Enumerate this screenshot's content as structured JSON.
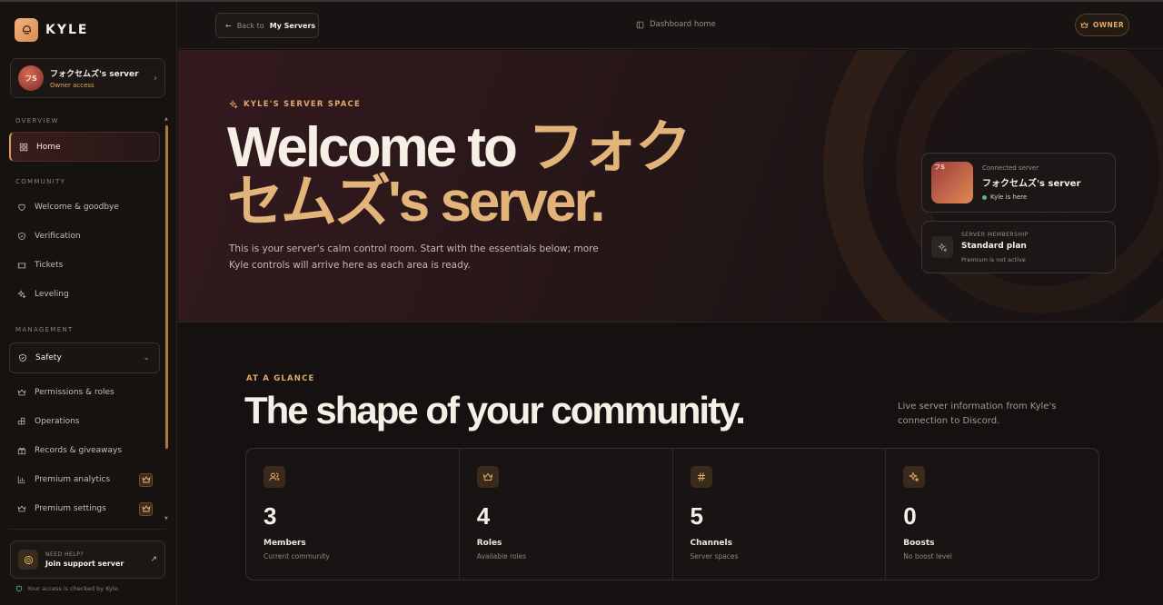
{
  "brand": {
    "name": "KYLE"
  },
  "server": {
    "initials": "フS",
    "name": "フォクセムズ's server",
    "access": "Owner access"
  },
  "sidebar": {
    "sections": {
      "overview": "OVERVIEW",
      "community": "COMMUNITY",
      "management": "MANAGEMENT"
    },
    "items": [
      {
        "label": "Home",
        "icon": "grid-icon"
      },
      {
        "label": "Welcome & goodbye",
        "icon": "heart-icon"
      },
      {
        "label": "Verification",
        "icon": "shield-check-icon"
      },
      {
        "label": "Tickets",
        "icon": "ticket-icon"
      },
      {
        "label": "Leveling",
        "icon": "sparkles-icon"
      },
      {
        "label": "Safety",
        "icon": "shield-icon"
      },
      {
        "label": "Permissions & roles",
        "icon": "crown-icon"
      },
      {
        "label": "Operations",
        "icon": "blocks-icon"
      },
      {
        "label": "Records & giveaways",
        "icon": "gift-icon"
      },
      {
        "label": "Premium analytics",
        "icon": "chart-icon"
      },
      {
        "label": "Premium settings",
        "icon": "crown-icon"
      }
    ],
    "help": {
      "kicker": "NEED HELP?",
      "title": "Join support server"
    },
    "access_note": "Your access is checked by Kyle."
  },
  "topbar": {
    "back_prefix": "Back to",
    "back_target": "My Servers",
    "dashboard": "Dashboard home",
    "role": "OWNER"
  },
  "hero": {
    "kicker": "KYLE'S SERVER SPACE",
    "title_lead": "Welcome to ",
    "title_accent": "フォクセムズ's server.",
    "description": "This is your server's calm control room. Start with the essentials below; more Kyle controls will arrive here as each area is ready.",
    "connected": {
      "kicker": "Connected server",
      "initials": "フS",
      "name": "フォクセムズ's server",
      "status": "Kyle is here"
    },
    "membership": {
      "kicker": "SERVER MEMBERSHIP",
      "plan": "Standard plan",
      "note": "Premium is not active"
    }
  },
  "glance": {
    "kicker": "AT A GLANCE",
    "title": "The shape of your community.",
    "note": "Live server information from Kyle's connection to Discord.",
    "stats": [
      {
        "value": "3",
        "label": "Members",
        "sub": "Current community",
        "icon": "users-icon"
      },
      {
        "value": "4",
        "label": "Roles",
        "sub": "Available roles",
        "icon": "crown-icon"
      },
      {
        "value": "5",
        "label": "Channels",
        "sub": "Server spaces",
        "icon": "hash-icon"
      },
      {
        "value": "0",
        "label": "Boosts",
        "sub": "No boost level",
        "icon": "sparkles-icon"
      }
    ]
  },
  "colors": {
    "accent": "#e0a868",
    "background": "#141110",
    "status_online": "#4cc07a"
  }
}
